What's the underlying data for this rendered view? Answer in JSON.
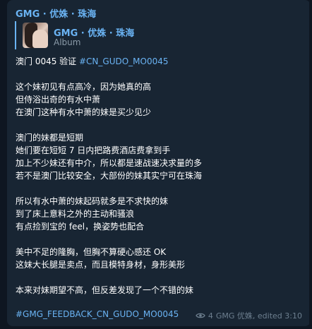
{
  "sender": "GMG · 优姝 · 珠海",
  "reply": {
    "title": "GMG · 优姝 · 珠海",
    "subtitle": "Album"
  },
  "post": {
    "header_text": "澳门 0045 验证 ",
    "header_tag": "#CN_GUDO_MO0045",
    "lines": [
      "这个妹初见有点高冷，因为她真的高",
      "但侍浴出奇的有水中萧",
      "在澳门这种有水中萧的妹是买少见少",
      "",
      "澳门的妹都是短期",
      "她们要在短短 7 日内把路费酒店费拿到手",
      "加上不少妹还有中介，所以都是速战速决求量的多",
      "若不是澳门比较安全，大部份的妹其实宁可在珠海",
      "",
      "所以有水中萧的妹起码就多是不求快的妹",
      "到了床上意料之外的主动和骚浪",
      "有点捡到宝的 feel，换姿势也配合",
      "",
      "美中不足的隆胸，但胸不算硬心感还 OK",
      "这妹大长腿是卖点，而且模特身材，身形美形",
      "",
      "本来对妹期望不高，但反差发现了一个不错的妹"
    ],
    "footer_tag": "#GMG_FEEDBACK_CN_GUDO_MO0045"
  },
  "meta": {
    "views": "4",
    "signature": "GMG 优姝, edited 3:10"
  },
  "colors": {
    "background": "#0e1621",
    "bubble": "#182533",
    "link": "#6ab3f3",
    "muted": "#6d7f8f"
  }
}
